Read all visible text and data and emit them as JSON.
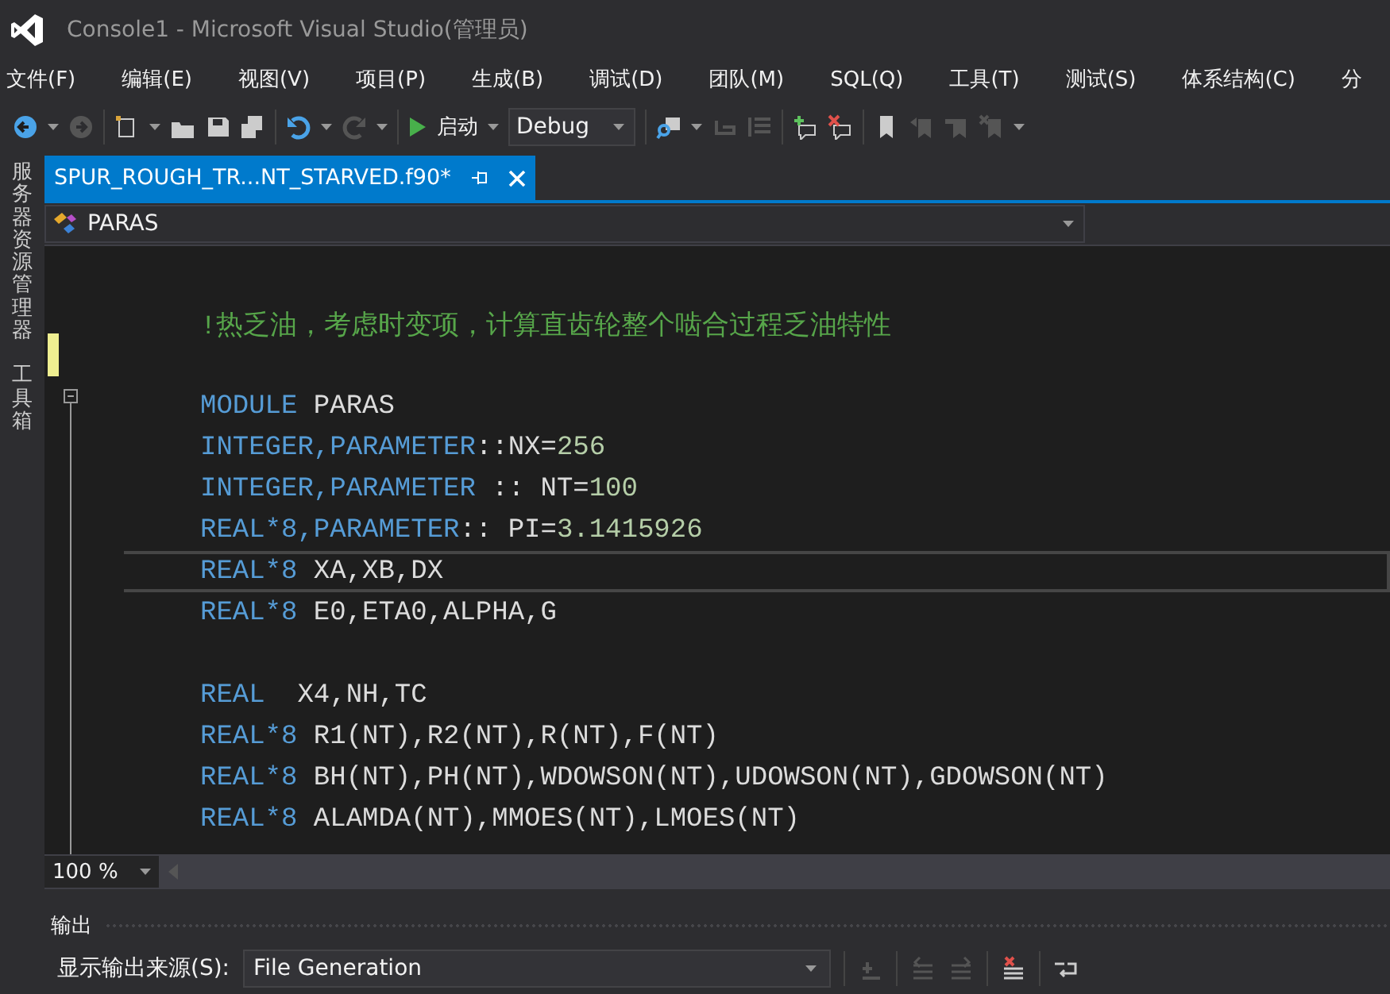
{
  "window": {
    "title": "Console1 - Microsoft Visual Studio(管理员)"
  },
  "menu": [
    "文件(F)",
    "编辑(E)",
    "视图(V)",
    "项目(P)",
    "生成(B)",
    "调试(D)",
    "团队(M)",
    "SQL(Q)",
    "工具(T)",
    "测试(S)",
    "体系结构(C)",
    "分"
  ],
  "toolbar": {
    "start_label": "启动",
    "configuration": "Debug"
  },
  "side_tabs": [
    "服务器资源管理器",
    "工具箱"
  ],
  "document_tab": {
    "title": "SPUR_ROUGH_TR...NT_STARVED.f90*",
    "selected": true
  },
  "navigation": {
    "scope": "PARAS"
  },
  "code_lines": [
    {
      "current": false
    },
    {
      "current": false,
      "tokens": [
        {
          "kind": "comment",
          "text": "!热乏油，考虑时变项，计算直齿轮整个啮合过程乏油特性"
        }
      ]
    },
    {
      "current": false
    },
    {
      "current": false,
      "tokens": [
        {
          "kind": "keyword",
          "text": "MODULE"
        },
        {
          "kind": "plain",
          "text": " PARAS"
        }
      ]
    },
    {
      "current": false,
      "tokens": [
        {
          "kind": "keyword",
          "text": "INTEGER,PARAMETER"
        },
        {
          "kind": "plain",
          "text": "::NX="
        },
        {
          "kind": "number",
          "text": "256"
        }
      ]
    },
    {
      "current": false,
      "tokens": [
        {
          "kind": "keyword",
          "text": "INTEGER,PARAMETER"
        },
        {
          "kind": "plain",
          "text": " :: NT="
        },
        {
          "kind": "number",
          "text": "100"
        }
      ]
    },
    {
      "current": false,
      "tokens": [
        {
          "kind": "keyword",
          "text": "REAL*8,PARAMETER"
        },
        {
          "kind": "plain",
          "text": ":: PI="
        },
        {
          "kind": "number",
          "text": "3.1415926"
        }
      ]
    },
    {
      "current": true,
      "tokens": [
        {
          "kind": "keyword",
          "text": "REAL*8"
        },
        {
          "kind": "plain",
          "text": " XA,XB,DX"
        }
      ]
    },
    {
      "current": false,
      "tokens": [
        {
          "kind": "keyword",
          "text": "REAL*8"
        },
        {
          "kind": "plain",
          "text": " E0,ETA0,ALPHA,G"
        }
      ]
    },
    {
      "current": false
    },
    {
      "current": false,
      "tokens": [
        {
          "kind": "keyword",
          "text": "REAL"
        },
        {
          "kind": "plain",
          "text": "  X4,NH,TC"
        }
      ]
    },
    {
      "current": false,
      "tokens": [
        {
          "kind": "keyword",
          "text": "REAL*8"
        },
        {
          "kind": "plain",
          "text": " R1(NT),R2(NT),R(NT),F(NT)"
        }
      ]
    },
    {
      "current": false,
      "tokens": [
        {
          "kind": "keyword",
          "text": "REAL*8"
        },
        {
          "kind": "plain",
          "text": " BH(NT),PH(NT),WDOWSON(NT),UDOWSON(NT),GDOWSON(NT)"
        }
      ]
    },
    {
      "current": false,
      "tokens": [
        {
          "kind": "keyword",
          "text": "REAL*8"
        },
        {
          "kind": "plain",
          "text": " ALAMDA(NT),MMOES(NT),LMOES(NT)"
        }
      ]
    }
  ],
  "zoom": "100 %",
  "output": {
    "title": "输出",
    "source_label": "显示输出来源(S):",
    "source": "File Generation"
  }
}
